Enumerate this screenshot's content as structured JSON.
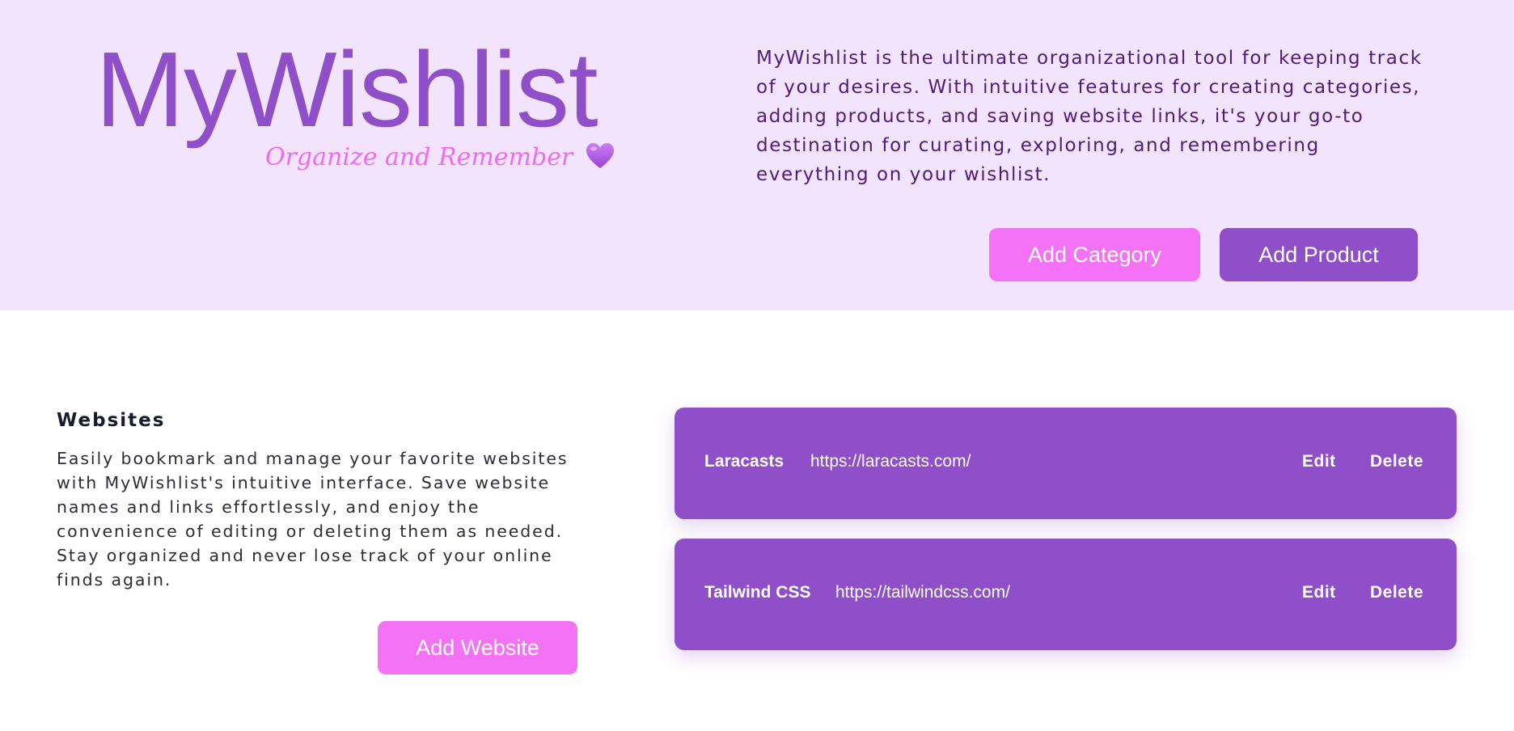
{
  "header": {
    "logo_title": "MyWishlist",
    "tagline": "Organize and Remember",
    "tagline_icon": "purple-heart-icon",
    "intro": "MyWishlist is the ultimate organizational tool for keeping track of your desires. With intuitive features for creating categories, adding products, and saving website links, it's your go-to destination for curating, exploring, and remembering everything on your wishlist.",
    "add_category_label": "Add Category",
    "add_product_label": "Add Product"
  },
  "websites": {
    "title": "Websites",
    "description": "Easily bookmark and manage your favorite websites with MyWishlist's intuitive interface. Save website names and links effortlessly, and enjoy the convenience of editing or deleting them as needed. Stay organized and never lose track of your online finds again.",
    "add_website_label": "Add Website",
    "items": [
      {
        "name": "Laracasts",
        "url": "https://laracasts.com/",
        "edit_label": "Edit",
        "delete_label": "Delete"
      },
      {
        "name": "Tailwind CSS",
        "url": "https://tailwindcss.com/",
        "edit_label": "Edit",
        "delete_label": "Delete"
      }
    ]
  },
  "colors": {
    "header_bg": "#f3e4fe",
    "primary_purple": "#8e4fc9",
    "accent_pink": "#f472f6",
    "intro_text": "#4e1c78"
  }
}
